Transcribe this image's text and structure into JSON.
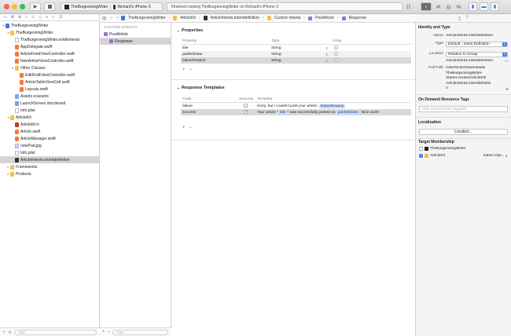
{
  "toolbar": {
    "scheme_app": "TheBurgeoningWriter",
    "scheme_device": "Richard's iPhone X",
    "activity": "Finished running TheBurgeoningWriter on Richard's iPhone X"
  },
  "navigator": {
    "items": [
      {
        "label": "TheBurgeoningWriter",
        "depth": 0,
        "icon": "project-icon",
        "disclosure": "▾"
      },
      {
        "label": "TheBurgeoningWriter",
        "depth": 1,
        "icon": "folder-icon",
        "disclosure": "▾"
      },
      {
        "label": "TheBurgeoningWriter.entitlements",
        "depth": 2,
        "icon": "document-icon",
        "disclosure": ""
      },
      {
        "label": "AppDelegate.swift",
        "depth": 2,
        "icon": "swift-file-icon",
        "disclosure": ""
      },
      {
        "label": "ArticleFeedViewController.swift",
        "depth": 2,
        "icon": "swift-file-icon",
        "disclosure": ""
      },
      {
        "label": "NewArticleViewController.swift",
        "depth": 2,
        "icon": "swift-file-icon",
        "disclosure": ""
      },
      {
        "label": "Other Classes",
        "depth": 2,
        "icon": "folder-icon",
        "disclosure": "▾"
      },
      {
        "label": "EditDraftViewController.swift",
        "depth": 3,
        "icon": "swift-file-icon",
        "disclosure": ""
      },
      {
        "label": "ArticleTableViewCell.swift",
        "depth": 3,
        "icon": "swift-file-icon",
        "disclosure": ""
      },
      {
        "label": "Layouts.swift",
        "depth": 3,
        "icon": "swift-file-icon",
        "disclosure": ""
      },
      {
        "label": "Assets.xcassets",
        "depth": 2,
        "icon": "assets-icon",
        "disclosure": ""
      },
      {
        "label": "LaunchScreen.storyboard",
        "depth": 2,
        "icon": "storyboard-icon",
        "disclosure": ""
      },
      {
        "label": "Info.plist",
        "depth": 2,
        "icon": "document-icon",
        "disclosure": ""
      },
      {
        "label": "ArticleKit",
        "depth": 1,
        "icon": "folder-icon",
        "disclosure": "▾"
      },
      {
        "label": "ArticleKit.h",
        "depth": 2,
        "icon": "header-file-icon",
        "disclosure": ""
      },
      {
        "label": "Article.swift",
        "depth": 2,
        "icon": "swift-file-icon",
        "disclosure": ""
      },
      {
        "label": "ArticleManager.swift",
        "depth": 2,
        "icon": "swift-file-icon",
        "disclosure": ""
      },
      {
        "label": "notePad.jpg",
        "depth": 2,
        "icon": "image-file-icon",
        "disclosure": ""
      },
      {
        "label": "Info.plist",
        "depth": 2,
        "icon": "document-icon",
        "disclosure": ""
      },
      {
        "label": "ArticleIntents.intentdefinition",
        "depth": 2,
        "icon": "intents-file-icon",
        "disclosure": "",
        "selected": true
      },
      {
        "label": "Frameworks",
        "depth": 1,
        "icon": "folder-icon",
        "disclosure": "▸"
      },
      {
        "label": "Products",
        "depth": 1,
        "icon": "folder-icon",
        "disclosure": "▸"
      }
    ],
    "filter_placeholder": "Filter"
  },
  "jumpbar": {
    "crumbs": [
      "TheBurgeoningWriter",
      "ArticleKit",
      "ArticleIntents.intentdefinition",
      "Custom Intents",
      "PostArticle",
      "Response"
    ]
  },
  "intents": {
    "header": "CUSTOM INTENTS",
    "items": [
      {
        "label": "PostArticle",
        "badge": "I"
      },
      {
        "label": "Response",
        "badge": "R"
      }
    ],
    "filter_placeholder": "Filter"
  },
  "properties": {
    "title": "Properties",
    "columns": [
      "Property",
      "Type",
      "Array"
    ],
    "rows": [
      {
        "name": "title",
        "type": "String"
      },
      {
        "name": "publishDate",
        "type": "String"
      },
      {
        "name": "failureReason",
        "type": "String"
      }
    ]
  },
  "response_templates": {
    "title": "Response Templates",
    "columns": [
      "Code",
      "Success",
      "Template"
    ],
    "rows": [
      {
        "code": "failure",
        "success": false,
        "template_pre": "Sorry, but I couldn't post your article: ",
        "token1": "failureReason",
        "template_mid": "",
        "token2": "",
        "template_post": ""
      },
      {
        "code": "success",
        "success": true,
        "template_pre": "Your article \"",
        "token1": "title",
        "template_mid": "\" was successfully posted on ",
        "token2": "publishDate",
        "template_post": ". Nice work!"
      }
    ]
  },
  "inspector": {
    "identity_title": "Identity and Type",
    "name_label": "Name",
    "name_value": "ArticleIntents.intentdefinition",
    "type_label": "Type",
    "type_value": "Default - Intent Definition",
    "location_label": "Location",
    "location_value": "Relative to Group",
    "location_file": "ArticleIntents.intentdefinition",
    "fullpath_label": "Full Path",
    "fullpath_value": [
      "/Users/critz/Downloads/",
      "TheBurgeoningWriter-",
      "Starter-review/ArticleKit/",
      "ArticleIntents.intentdefinitio",
      "n"
    ],
    "odr_title": "On Demand Resource Tags",
    "odr_placeholder": "Only resources are taggable",
    "localization_title": "Localization",
    "localize_button": "Localize...",
    "target_title": "Target Membership",
    "targets": [
      {
        "label": "TheBurgeoningWriter",
        "checked": false,
        "extra": ""
      },
      {
        "label": "ArticleKit",
        "checked": true,
        "extra": "Intent Clas..."
      }
    ]
  }
}
